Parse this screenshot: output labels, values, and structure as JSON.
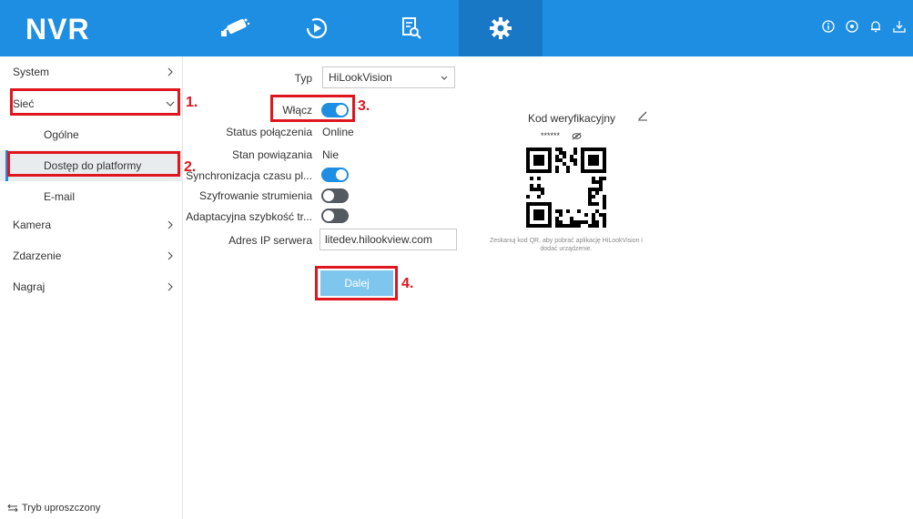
{
  "topbar": {
    "logo": "NVR",
    "nav": [
      {
        "icon": "camera-live-view-icon"
      },
      {
        "icon": "playback-icon"
      },
      {
        "icon": "search-file-icon"
      },
      {
        "icon": "gear-icon",
        "active": true
      }
    ],
    "right_icons": [
      "info-icon",
      "target-icon",
      "bell-icon",
      "download-icon"
    ],
    "bg_color": "#1e8ee3"
  },
  "sidebar": {
    "items": [
      {
        "label": "System"
      },
      {
        "label": "Sieć"
      },
      {
        "label": "Ogólne"
      },
      {
        "label": "Dostęp do platformy"
      },
      {
        "label": "E-mail"
      },
      {
        "label": "Kamera"
      },
      {
        "label": "Zdarzenie"
      },
      {
        "label": "Nagraj"
      }
    ],
    "simple_mode": "Tryb uproszczony"
  },
  "form": {
    "type_label": "Typ",
    "type_value": "HiLookVision",
    "enable_label": "Włącz",
    "enable_on": true,
    "status_label": "Status połączenia",
    "status_value": "Online",
    "binding_label": "Stan powiązania",
    "binding_value": "Nie",
    "sync_label": "Synchronizacja czasu pl...",
    "sync_on": true,
    "encrypt_label": "Szyfrowanie strumienia",
    "encrypt_on": false,
    "adaptive_label": "Adaptacyjna szybkość tr...",
    "adaptive_on": false,
    "server_label": "Adres IP serwera",
    "server_value": "litedev.hilookview.com",
    "next_label": "Dalej"
  },
  "verification": {
    "label": "Kod weryfikacyjny",
    "masked": "******",
    "qr_caption": "Zeskanuj kod QR, aby pobrać aplikację HiLookVision i dodać urządzenie."
  },
  "annotations": [
    "1.",
    "2.",
    "3.",
    "4."
  ],
  "colors": {
    "accent": "#1e8ee3",
    "annotation": "#e0161e",
    "button": "#7ec6ee"
  }
}
